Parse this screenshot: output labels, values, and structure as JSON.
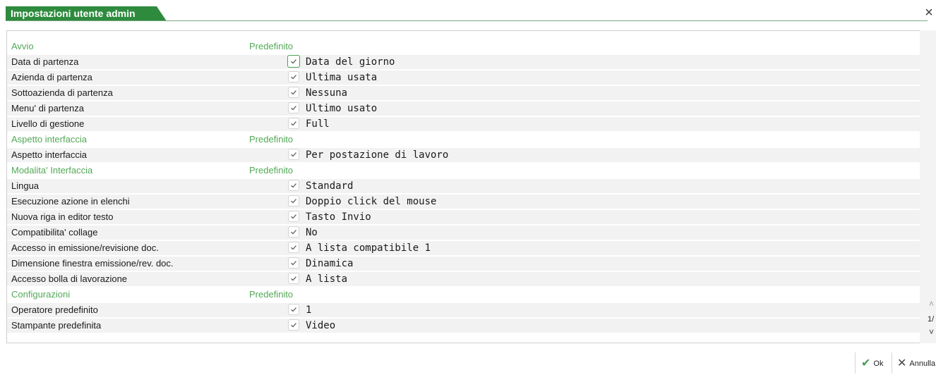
{
  "window": {
    "title": "Impostazioni utente admin",
    "close_icon": "×"
  },
  "sections": [
    {
      "title": "Avvio",
      "default_label": "Predefinito",
      "items": [
        {
          "label": "Data di partenza",
          "value": "Data del giorno",
          "checked": true
        },
        {
          "label": "Azienda di partenza",
          "value": "Ultima usata",
          "checked": true
        },
        {
          "label": "Sottoazienda di partenza",
          "value": "Nessuna",
          "checked": true
        },
        {
          "label": "Menu' di partenza",
          "value": "Ultimo usato",
          "checked": true
        },
        {
          "label": "Livello di gestione",
          "value": "Full",
          "checked": true
        }
      ]
    },
    {
      "title": "Aspetto interfaccia",
      "default_label": "Predefinito",
      "items": [
        {
          "label": "Aspetto interfaccia",
          "value": "Per postazione di lavoro",
          "checked": true
        }
      ]
    },
    {
      "title": "Modalita' Interfaccia",
      "default_label": "Predefinito",
      "items": [
        {
          "label": "Lingua",
          "value": "Standard",
          "checked": true
        },
        {
          "label": "Esecuzione azione in elenchi",
          "value": "Doppio click del mouse",
          "checked": true
        },
        {
          "label": "Nuova riga in editor testo",
          "value": "Tasto Invio",
          "checked": true
        },
        {
          "label": "Compatibilita' collage",
          "value": "No",
          "checked": true
        },
        {
          "label": "Accesso in emissione/revisione doc.",
          "value": "A lista compatibile 1",
          "checked": true
        },
        {
          "label": "Dimensione finestra emissione/rev. doc.",
          "value": "Dinamica",
          "checked": true
        },
        {
          "label": "Accesso bolla di lavorazione",
          "value": "A lista",
          "checked": true
        }
      ]
    },
    {
      "title": "Configurazioni",
      "default_label": "Predefinito",
      "items": [
        {
          "label": "Operatore predefinito",
          "value": "1",
          "checked": true
        },
        {
          "label": "Stampante predefinita",
          "value": "Video",
          "checked": true
        }
      ]
    }
  ],
  "pager": {
    "indicator": "1/",
    "up_icon": "double-chevron-up-icon",
    "down_icon": "double-chevron-down-icon"
  },
  "buttons": {
    "ok_label": "Ok",
    "cancel_label": "Annulla"
  },
  "colors": {
    "accent": "#2e8b3e",
    "section_text": "#53a857",
    "row_bg": "#f2f2f2"
  }
}
